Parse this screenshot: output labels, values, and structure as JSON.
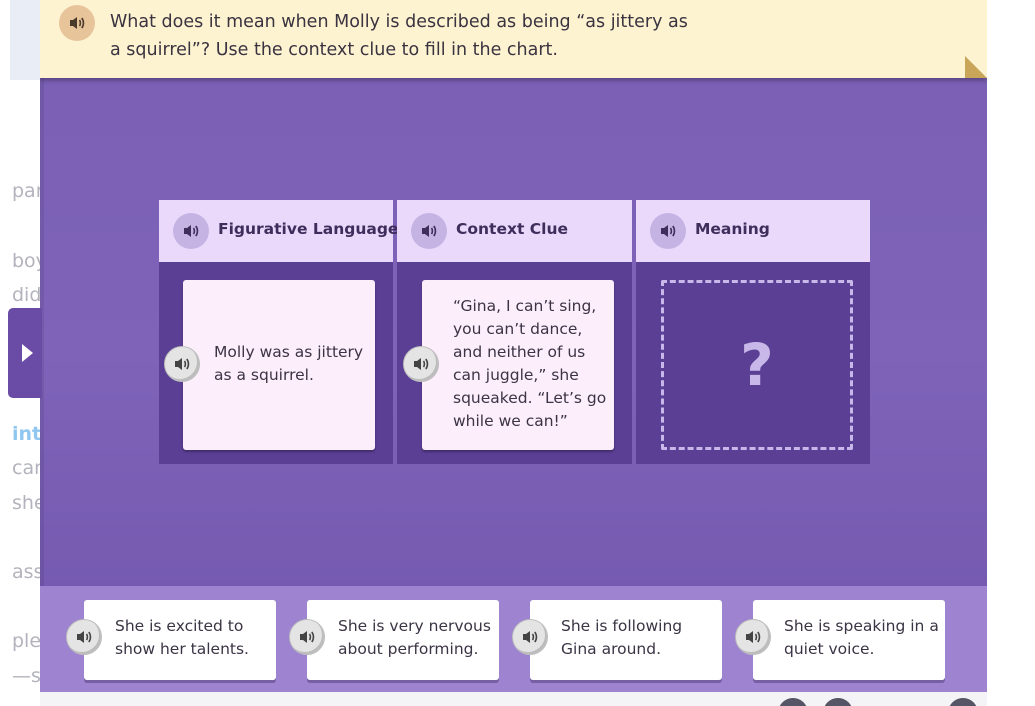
{
  "background_passage": {
    "fragments": [
      "par",
      "boy",
      "did",
      "inti",
      "car",
      "she",
      "ass",
      "ple",
      "—s"
    ]
  },
  "prompt": {
    "text": "What does it mean when Molly is described as being “as jittery as a squirrel”? Use the context clue to fill in the chart."
  },
  "chart": {
    "columns": [
      {
        "header": "Figurative Language",
        "content": "Molly was as jittery as a squirrel."
      },
      {
        "header": "Context Clue",
        "content": "“Gina, I can’t sing, you can’t dance, and neither of us can juggle,” she squeaked. “Let’s go while we can!”"
      },
      {
        "header": "Meaning",
        "placeholder": "?"
      }
    ]
  },
  "answers": [
    {
      "text": "She is excited to show her talents."
    },
    {
      "text": "She is very nervous about performing."
    },
    {
      "text": "She is following Gina around."
    },
    {
      "text": "She is speaking in a quiet voice."
    }
  ],
  "icons": {
    "audio": "speaker-icon",
    "side_tab": "triangle-right-icon"
  },
  "colors": {
    "panel": "#7a5fb4",
    "prompt_bg": "#fdf3d1",
    "column_header": "#ead9fb",
    "column_body": "#5b3f95",
    "card": "#fdeefc",
    "tray": "#9e84d0"
  }
}
